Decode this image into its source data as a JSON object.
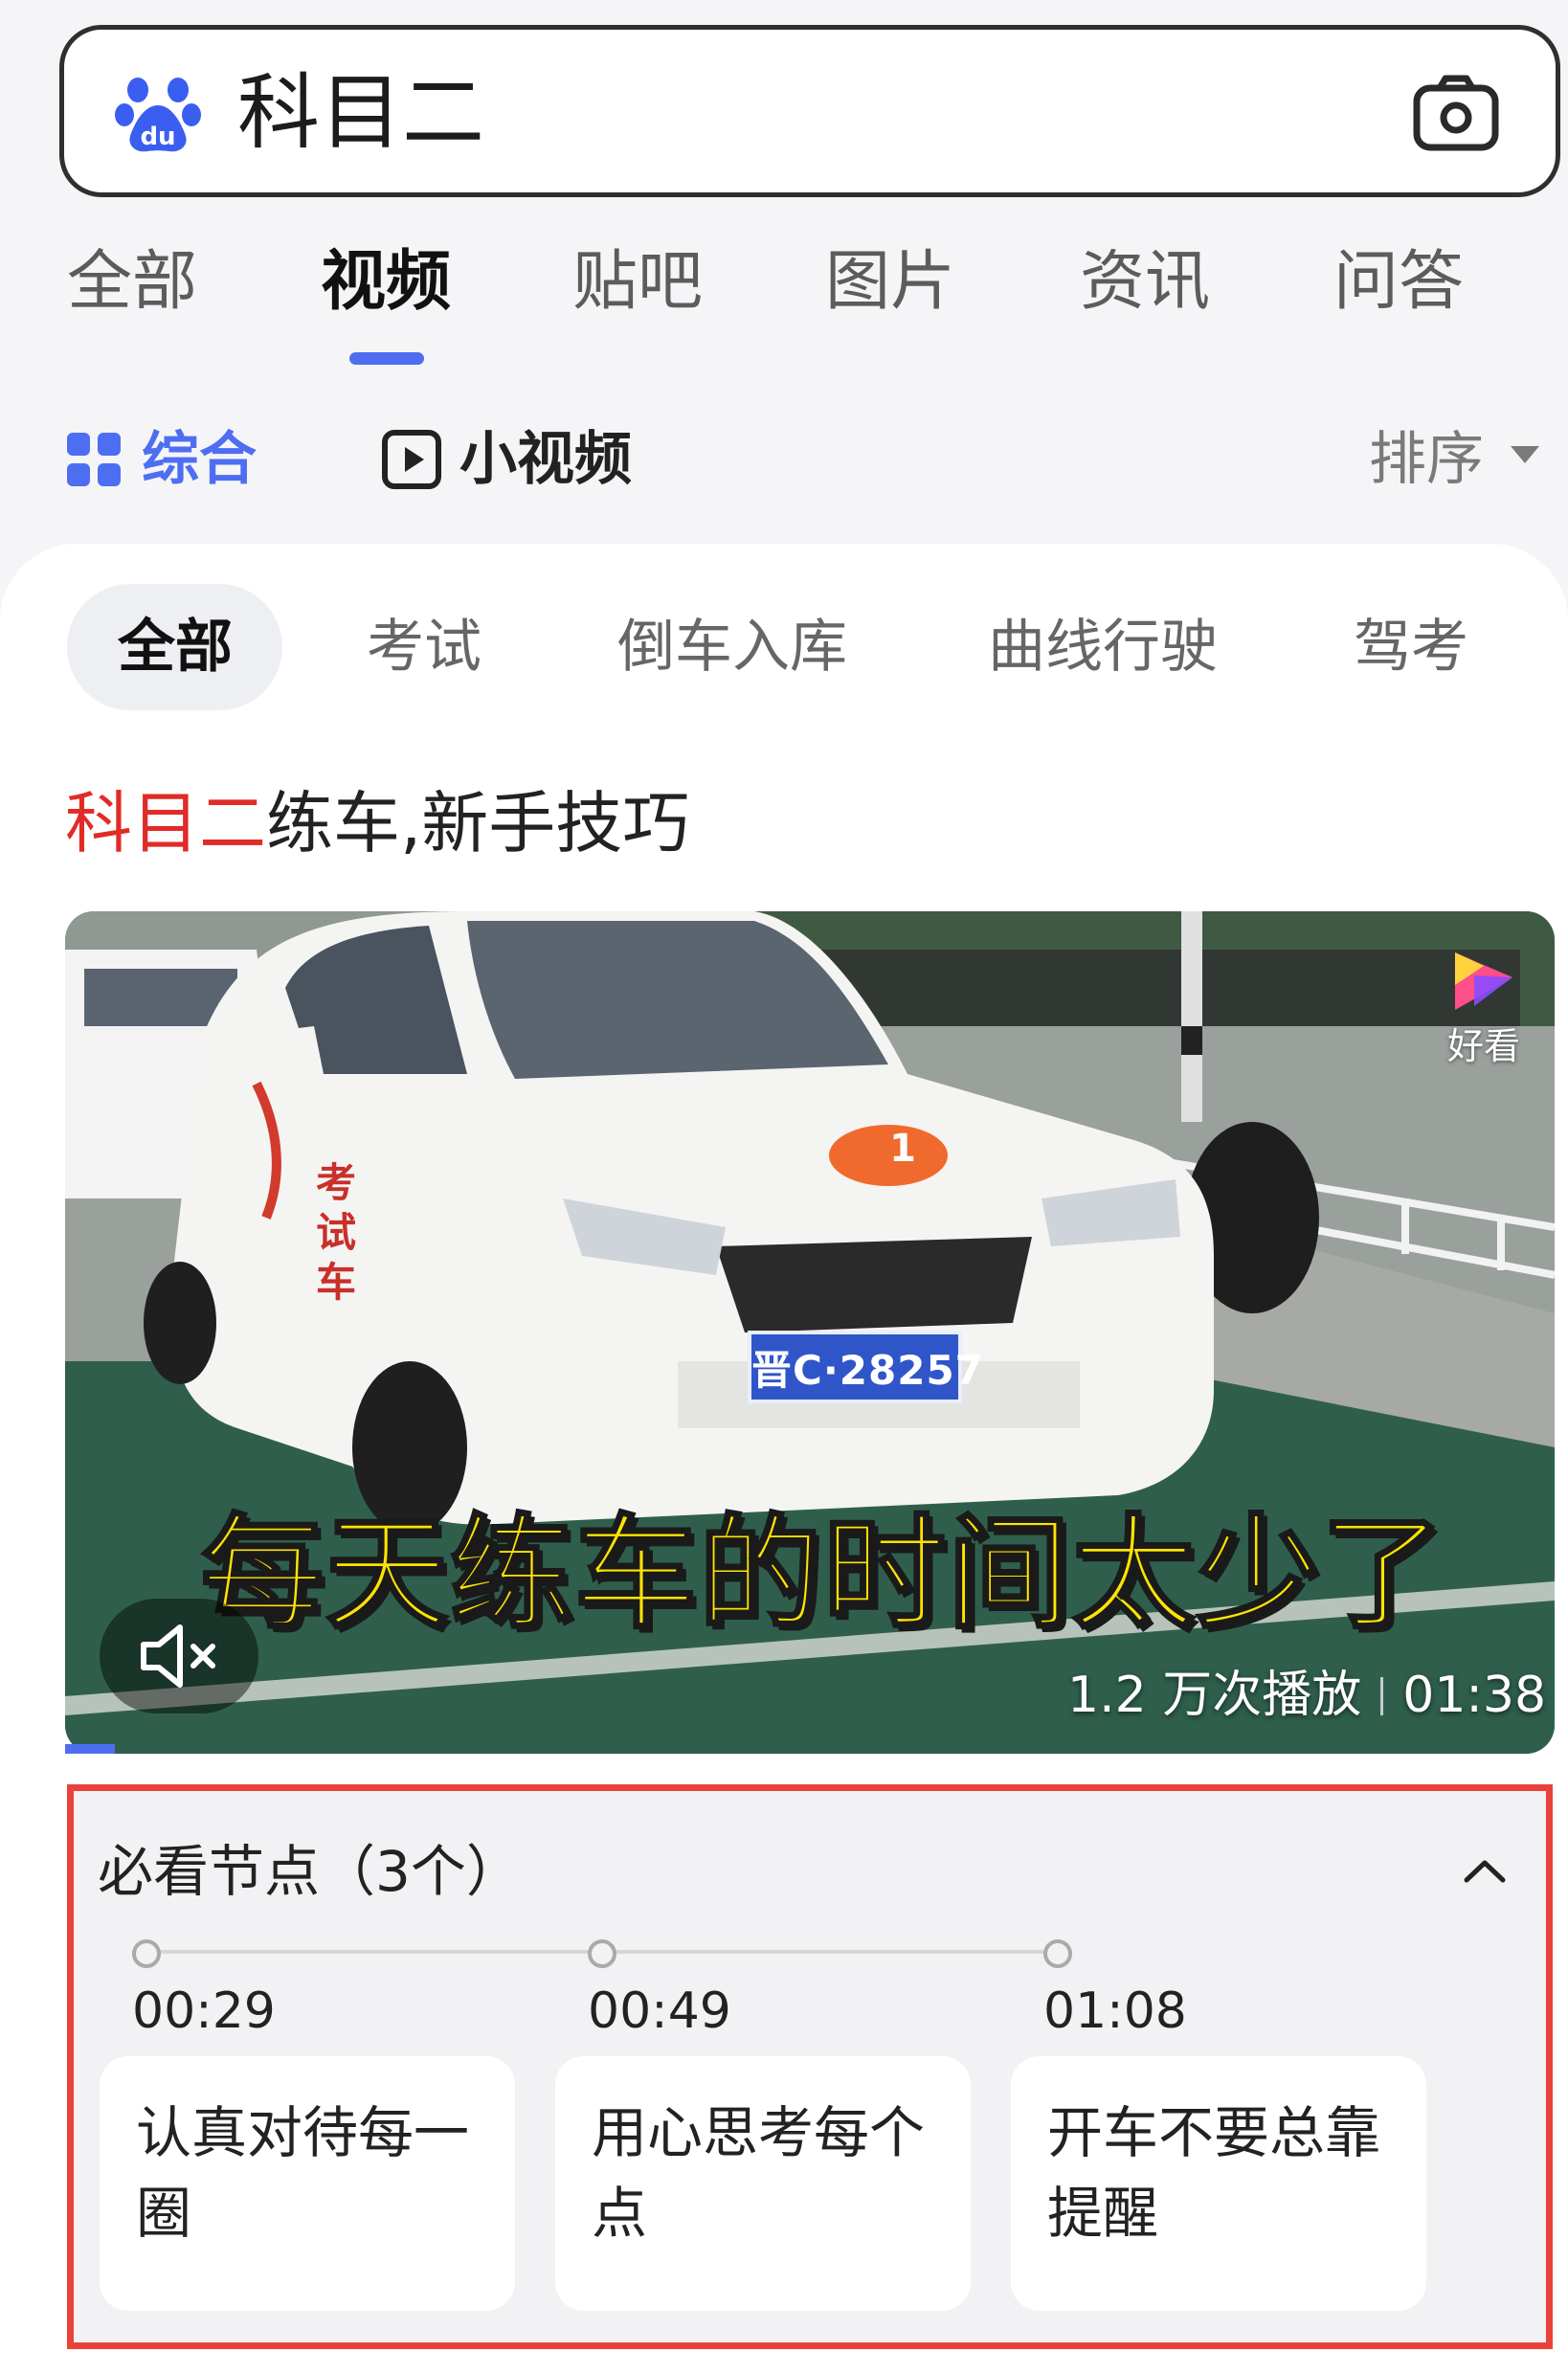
{
  "search": {
    "query": "科目二",
    "logo": "baidu-paw-logo",
    "camera_icon": "camera-icon"
  },
  "tabs": [
    "全部",
    "视频",
    "贴吧",
    "图片",
    "资讯",
    "问答"
  ],
  "active_tab": "视频",
  "subtabs": {
    "zonghe": "综合",
    "xiaoshipin": "小视频",
    "sort": "排序"
  },
  "chips": [
    "全部",
    "考试",
    "倒车入库",
    "曲线行驶",
    "驾考"
  ],
  "result": {
    "title_highlight": "科目二",
    "title_rest": "练车,新手技巧",
    "caption": "每天练车的时间太少了",
    "views": "1.2 万次播放",
    "duration": "01:38",
    "plate": "晋C·28257",
    "badge_number": "1",
    "door_text": "考试车",
    "source_label": "好看"
  },
  "chapters": {
    "title": "必看节点（3个）",
    "items": [
      {
        "time": "00:29",
        "text": "认真对待每一圈"
      },
      {
        "time": "00:49",
        "text": "用心思考每个点"
      },
      {
        "time": "01:08",
        "text": "开车不要总靠提醒"
      }
    ]
  },
  "colors": {
    "accent": "#4e6ef2",
    "highlight": "#e02b26",
    "outline": "#e8423a",
    "caption": "#ffe400"
  }
}
